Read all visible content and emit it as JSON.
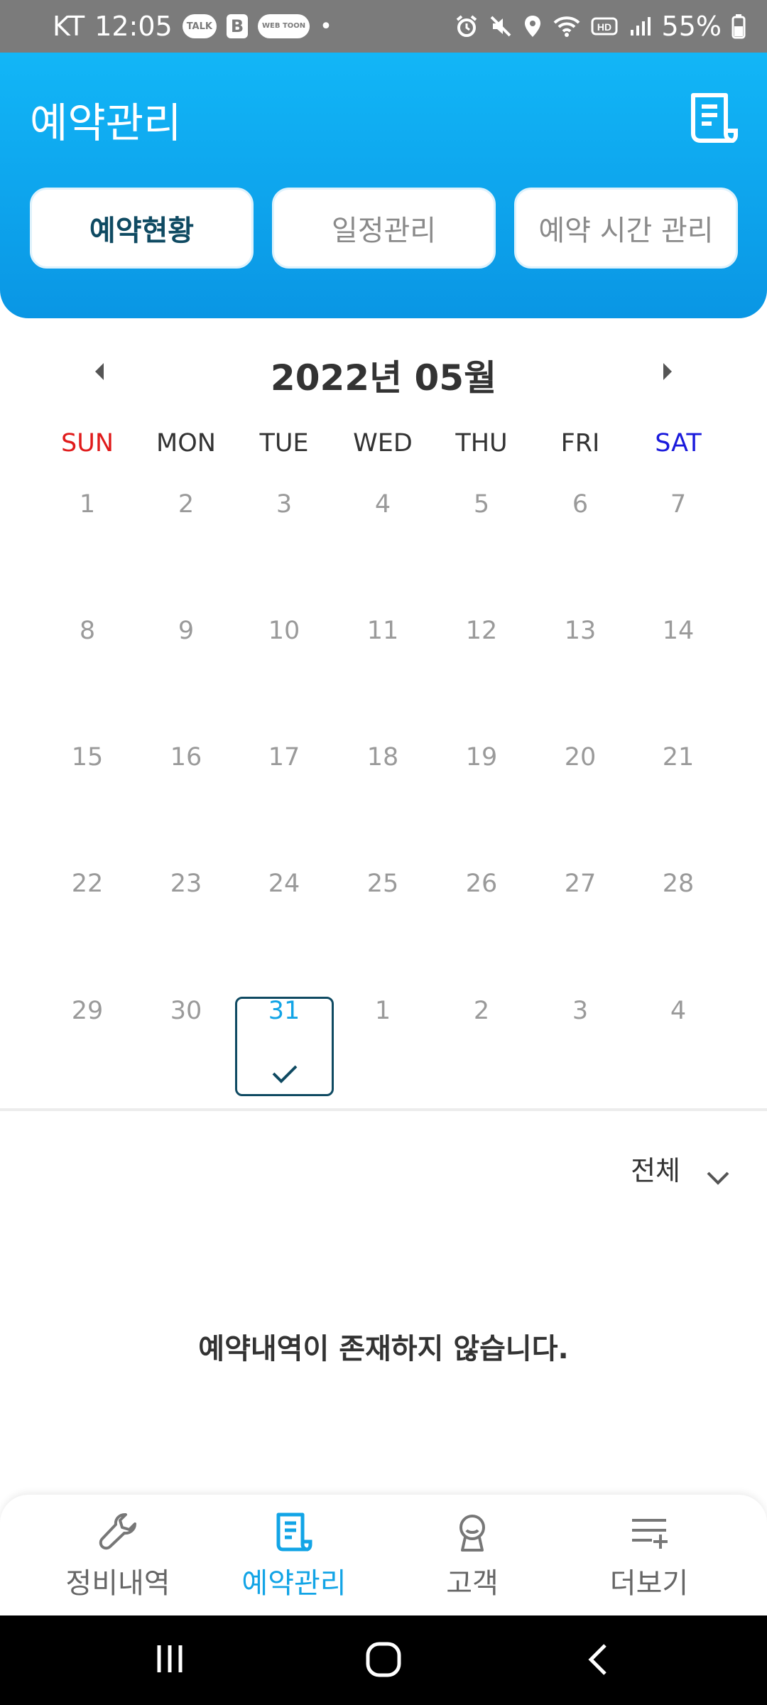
{
  "status_bar": {
    "carrier": "KT",
    "time": "12:05",
    "talk_badge": "TALK",
    "b_badge": "B",
    "webtoon_badge": "WEB TOON",
    "dot": "•",
    "battery": "55%",
    "icons": [
      "alarm-icon",
      "mute-icon",
      "location-icon",
      "wifi-icon",
      "hd-icon",
      "signal-icon",
      "battery-icon"
    ]
  },
  "header": {
    "title": "예약관리",
    "doc_icon": "document-icon",
    "tabs": [
      {
        "label": "예약현황",
        "active": true
      },
      {
        "label": "일정관리",
        "active": false
      },
      {
        "label": "예약 시간 관리",
        "active": false
      }
    ]
  },
  "calendar": {
    "month_title": "2022년 05월",
    "weekdays": [
      "SUN",
      "MON",
      "TUE",
      "WED",
      "THU",
      "FRI",
      "SAT"
    ],
    "weeks": [
      [
        "1",
        "2",
        "3",
        "4",
        "5",
        "6",
        "7"
      ],
      [
        "8",
        "9",
        "10",
        "11",
        "12",
        "13",
        "14"
      ],
      [
        "15",
        "16",
        "17",
        "18",
        "19",
        "20",
        "21"
      ],
      [
        "22",
        "23",
        "24",
        "25",
        "26",
        "27",
        "28"
      ],
      [
        "29",
        "30",
        "31",
        "1",
        "2",
        "3",
        "4"
      ]
    ],
    "selected_day": "31"
  },
  "filter": {
    "label": "전체"
  },
  "empty_message": "예약내역이 존재하지 않습니다.",
  "bottom_nav": [
    {
      "label": "정비내역",
      "icon": "wrench-icon",
      "active": false
    },
    {
      "label": "예약관리",
      "icon": "document-icon",
      "active": true
    },
    {
      "label": "고객",
      "icon": "person-icon",
      "active": false
    },
    {
      "label": "더보기",
      "icon": "more-list-icon",
      "active": false
    }
  ],
  "colors": {
    "header": "#12b6f7",
    "accent": "#12a4e6",
    "active_tab_text": "#0f4a62",
    "sunday": "#e01b1b",
    "saturday": "#1a1adc"
  }
}
